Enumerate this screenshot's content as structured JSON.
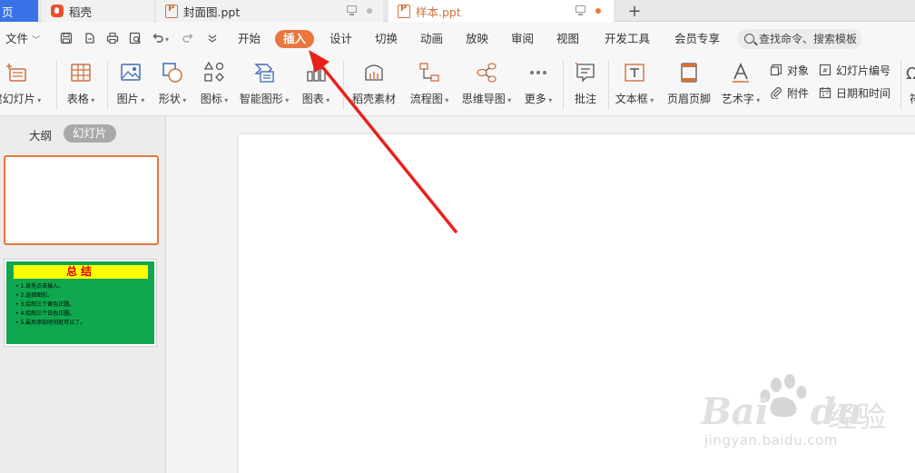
{
  "tabs": {
    "home": "页",
    "daoke": "稻壳",
    "cover": "封面图.ppt",
    "sample": "样本.ppt",
    "add": "+"
  },
  "menu": {
    "file": "文件",
    "items": [
      "开始",
      "插入",
      "设计",
      "切换",
      "动画",
      "放映",
      "审阅",
      "视图",
      "开发工具",
      "会员专享"
    ],
    "active_index": 1,
    "search": "查找命令、搜索模板"
  },
  "ribbon": {
    "new_slide": "建幻灯片",
    "table": "表格",
    "picture": "图片",
    "shape": "形状",
    "icon": "图标",
    "smart_graphic": "智能图形",
    "chart": "图表",
    "daoke_material": "稻壳素材",
    "flowchart": "流程图",
    "mindmap": "思维导图",
    "more": "更多",
    "comment": "批注",
    "textbox": "文本框",
    "header_footer": "页眉页脚",
    "wordart": "艺术字",
    "object": "对象",
    "attachment": "附件",
    "slide_number": "幻灯片编号",
    "date_time": "日期和时间",
    "cut_off": "符"
  },
  "panel": {
    "outline": "大纲",
    "slides": "幻灯片"
  },
  "slide2": {
    "title": "总结",
    "lines": [
      "1.首先点击插入。",
      "2.选择图形。",
      "3.绘制三个黄色正圆。",
      "4.绘制三个白色正圆。",
      "5.最后添加时间就可以了。"
    ]
  },
  "watermark": {
    "brand": "Bai",
    "brand2": "du",
    "cn": "经验",
    "url": "jingyan.baidu.com"
  },
  "colors": {
    "accent": "#e9763e",
    "home_tab": "#3a73e8",
    "arrow": "#e8221b",
    "slide_green": "#0fa850",
    "slide_title_bg": "#ffff00",
    "slide_title_text": "#e00000"
  }
}
